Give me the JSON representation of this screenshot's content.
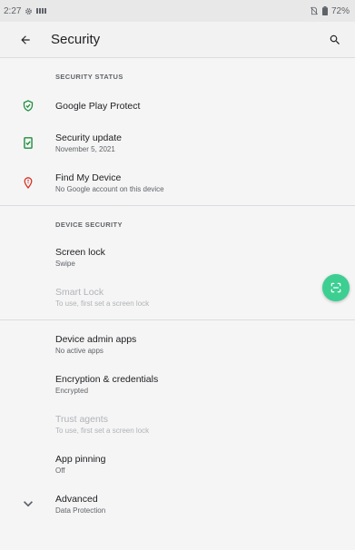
{
  "status_bar": {
    "time": "2:27",
    "battery": "72%"
  },
  "app_bar": {
    "title": "Security"
  },
  "sections": {
    "security_status": {
      "header": "SECURITY STATUS",
      "play_protect": {
        "title": "Google Play Protect"
      },
      "security_update": {
        "title": "Security update",
        "summary": "November 5, 2021"
      },
      "find_my_device": {
        "title": "Find My Device",
        "summary": "No Google account on this device"
      }
    },
    "device_security": {
      "header": "DEVICE SECURITY",
      "screen_lock": {
        "title": "Screen lock",
        "summary": "Swipe"
      },
      "smart_lock": {
        "title": "Smart Lock",
        "summary": "To use, first set a screen lock"
      }
    },
    "other": {
      "device_admin": {
        "title": "Device admin apps",
        "summary": "No active apps"
      },
      "encryption": {
        "title": "Encryption & credentials",
        "summary": "Encrypted"
      },
      "trust_agents": {
        "title": "Trust agents",
        "summary": "To use, first set a screen lock"
      },
      "app_pinning": {
        "title": "App pinning",
        "summary": "Off"
      },
      "advanced": {
        "title": "Advanced",
        "summary": "Data Protection"
      }
    }
  },
  "icons": {
    "back": "arrow-back-icon",
    "search": "search-icon",
    "play_protect": "shield-check-icon",
    "security_update": "phone-check-icon",
    "find_my_device": "location-pin-icon",
    "advanced": "chevron-down-icon",
    "fab": "scan-icon"
  },
  "colors": {
    "accent_green": "#1e8e3e",
    "alert_red": "#d93025",
    "fab_green": "#3ccf91"
  }
}
